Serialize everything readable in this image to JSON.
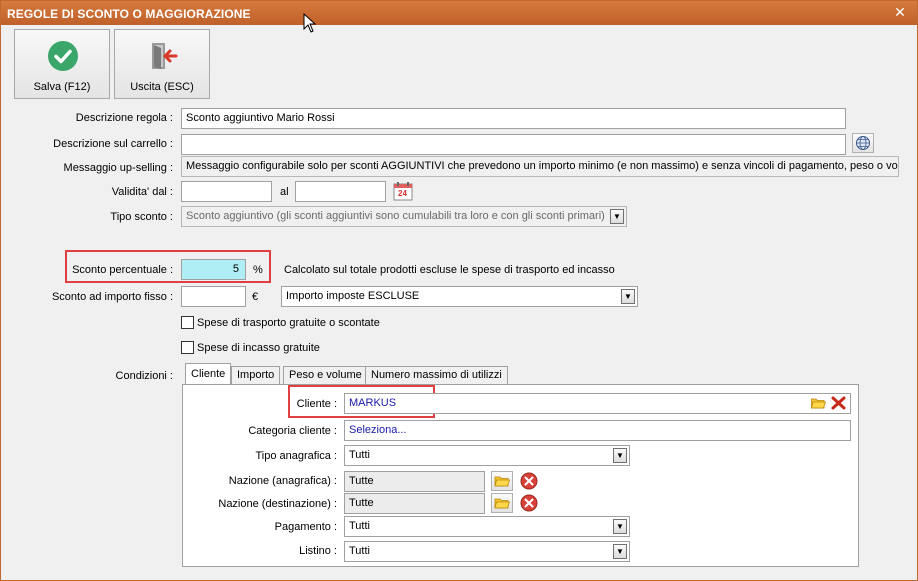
{
  "window": {
    "title": "REGOLE DI SCONTO O MAGGIORAZIONE",
    "close_glyph": "✕"
  },
  "toolbar": {
    "save_label": "Salva (F12)",
    "exit_label": "Uscita (ESC)",
    "save_icon": "check-circle-icon",
    "exit_icon": "exit-door-icon",
    "accent_green": "#3aa66a",
    "accent_red": "#d83a2a"
  },
  "form": {
    "descrizione_regola_label": "Descrizione regola :",
    "descrizione_regola_value": "Sconto aggiuntivo Mario Rossi",
    "descrizione_carrello_label": "Descrizione sul carrello :",
    "descrizione_carrello_value": "",
    "messaggio_label": "Messaggio up-selling :",
    "messaggio_value": "Messaggio configurabile solo per sconti AGGIUNTIVI che prevedono un importo minimo (e non massimo) e senza vincoli di pagamento, peso o volume",
    "validita_label": "Validita' dal :",
    "validita_dal": "",
    "validita_al_label": "al",
    "validita_al": "",
    "calendar_day": "24",
    "tipo_sconto_label": "Tipo sconto :",
    "tipo_sconto_value": "Sconto aggiuntivo (gli sconti aggiuntivi sono cumulabili tra loro e con gli sconti primari)",
    "sconto_percentuale_label": "Sconto percentuale :",
    "sconto_percentuale_value": "5",
    "percent_symbol": "%",
    "calcolato_note": "Calcolato sul totale prodotti escluse le spese di trasporto ed incasso",
    "sconto_importo_label": "Sconto ad importo fisso :",
    "sconto_importo_value": "",
    "euro_symbol": "€",
    "imposte_value": "Importo imposte ESCLUSE",
    "spese_trasporto_label": "Spese di trasporto gratuite o scontate",
    "spese_incasso_label": "Spese di incasso gratuite",
    "condizioni_label": "Condizioni :"
  },
  "tabs": [
    {
      "label": "Cliente"
    },
    {
      "label": "Importo"
    },
    {
      "label": "Peso e volume"
    },
    {
      "label": "Numero massimo di utilizzi"
    }
  ],
  "cliente_tab": {
    "cliente_label": "Cliente :",
    "cliente_value": "MARKUS",
    "categoria_label": "Categoria cliente :",
    "categoria_value": "Seleziona...",
    "tipo_anagrafica_label": "Tipo anagrafica :",
    "tipo_anagrafica_value": "Tutti",
    "nazione_anagrafica_label": "Nazione (anagrafica) :",
    "nazione_anagrafica_value": "Tutte",
    "nazione_destinazione_label": "Nazione (destinazione) :",
    "nazione_destinazione_value": "Tutte",
    "pagamento_label": "Pagamento :",
    "pagamento_value": "Tutti",
    "listino_label": "Listino :",
    "listino_value": "Tutti"
  },
  "highlight_color": "#e04040"
}
